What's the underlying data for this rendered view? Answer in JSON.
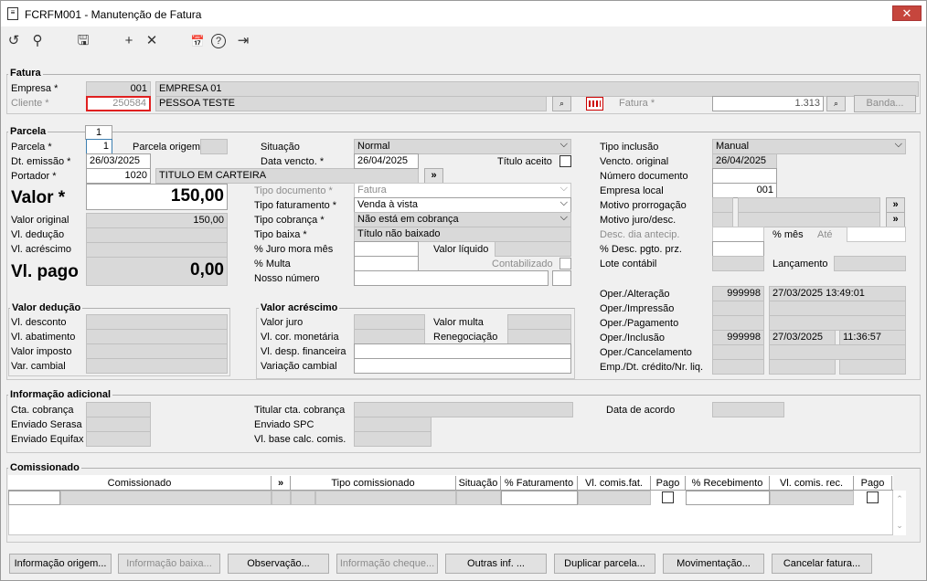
{
  "window": {
    "title": "FCRFM001 - Manutenção de Fatura",
    "close": "✕"
  },
  "toolbar": {
    "undo": "↺",
    "search": "⚲",
    "save": "🖫",
    "add": "+",
    "delete": "✕",
    "calendar": "📅",
    "help": "?",
    "exit": "⇥"
  },
  "fatura": {
    "title": "Fatura",
    "empresa_label": "Empresa *",
    "empresa_code": "001",
    "empresa_name": "EMPRESA 01",
    "cliente_label": "Cliente *",
    "cliente_code": "250584",
    "cliente_name": "PESSOA TESTE",
    "fatura_label": "Fatura *",
    "fatura_value": "1.313",
    "banda": "Banda..."
  },
  "parcela": {
    "title": "Parcela",
    "tab": "1",
    "parcela_label": "Parcela *",
    "parcela_value": "1",
    "parcela_origem_label": "Parcela origem",
    "dt_emissao_label": "Dt. emissão *",
    "dt_emissao": "26/03/2025",
    "portador_label": "Portador *",
    "portador_code": "1020",
    "portador_name": "TITULO EM CARTEIRA",
    "valor_label": "Valor *",
    "valor": "150,00",
    "valor_original_label": "Valor original",
    "valor_original": "150,00",
    "vl_deducao_label": "Vl. dedução",
    "vl_acrescimo_label": "Vl. acréscimo",
    "vl_pago_label": "Vl. pago",
    "vl_pago": "0,00",
    "situacao_label": "Situação",
    "situacao": "Normal",
    "data_vencto_label": "Data vencto. *",
    "data_vencto": "26/04/2025",
    "titulo_aceito_label": "Título aceito",
    "tipo_documento_label": "Tipo documento *",
    "tipo_documento": "Fatura",
    "tipo_faturamento_label": "Tipo faturamento *",
    "tipo_faturamento": "Venda à vista",
    "tipo_cobranca_label": "Tipo cobrança *",
    "tipo_cobranca": "Não está em cobrança",
    "tipo_baixa_label": "Tipo baixa *",
    "tipo_baixa": "Título não baixado",
    "juro_label": "% Juro mora mês",
    "valor_liquido_label": "Valor líquido",
    "multa_label": "% Multa",
    "contabilizado_label": "Contabilizado",
    "nosso_numero_label": "Nosso número",
    "tipo_inclusao_label": "Tipo inclusão",
    "tipo_inclusao": "Manual",
    "vencto_original_label": "Vencto. original",
    "vencto_original": "26/04/2025",
    "numero_documento_label": "Número documento",
    "empresa_local_label": "Empresa local",
    "empresa_local": "001",
    "motivo_prorrogacao_label": "Motivo prorrogação",
    "motivo_juro_label": "Motivo juro/desc.",
    "desc_dia_label": "Desc. dia antecip.",
    "pct_mes_label": "% mês",
    "ate_label": "Até",
    "desc_pgto_label": "% Desc. pgto. prz.",
    "lote_contabil_label": "Lote contábil",
    "lancamento_label": "Lançamento"
  },
  "deducao": {
    "title": "Valor dedução",
    "desconto": "Vl. desconto",
    "abatimento": "Vl. abatimento",
    "imposto": "Valor imposto",
    "cambial": "Var. cambial"
  },
  "acrescimo": {
    "title": "Valor acréscimo",
    "juro": "Valor juro",
    "cor_monetaria": "Vl. cor. monetária",
    "desp_financeira": "Vl. desp. financeira",
    "var_cambial": "Variação cambial",
    "multa": "Valor multa",
    "renegociacao": "Renegociação"
  },
  "oper": {
    "alteracao_label": "Oper./Alteração",
    "alteracao_user": "999998",
    "alteracao_date": "27/03/2025 13:49:01",
    "impressao_label": "Oper./Impressão",
    "pagamento_label": "Oper./Pagamento",
    "inclusao_label": "Oper./Inclusão",
    "inclusao_user": "999998",
    "inclusao_date": "27/03/2025",
    "inclusao_time": "11:36:57",
    "cancelamento_label": "Oper./Cancelamento",
    "emp_dt_label": "Emp./Dt. crédito/Nr. liq."
  },
  "info": {
    "title": "Informação adicional",
    "cta_cobranca": "Cta. cobrança",
    "enviado_serasa": "Enviado Serasa",
    "enviado_equifax": "Enviado Equifax",
    "titular_cta": "Titular cta. cobrança",
    "enviado_spc": "Enviado SPC",
    "vl_base": "Vl. base calc. comis.",
    "data_acordo": "Data de acordo"
  },
  "comissionado": {
    "title": "Comissionado",
    "columns": [
      "Comissionado",
      "»",
      "Tipo comissionado",
      "Situação",
      "% Faturamento",
      "Vl. comis.fat.",
      "Pago",
      "% Recebimento",
      "Vl. comis. rec.",
      "Pago"
    ]
  },
  "buttons": [
    "Informação origem...",
    "Informação baixa...",
    "Observação...",
    "Informação cheque...",
    "Outras inf. ...",
    "Duplicar parcela...",
    "Movimentação...",
    "Cancelar fatura..."
  ]
}
